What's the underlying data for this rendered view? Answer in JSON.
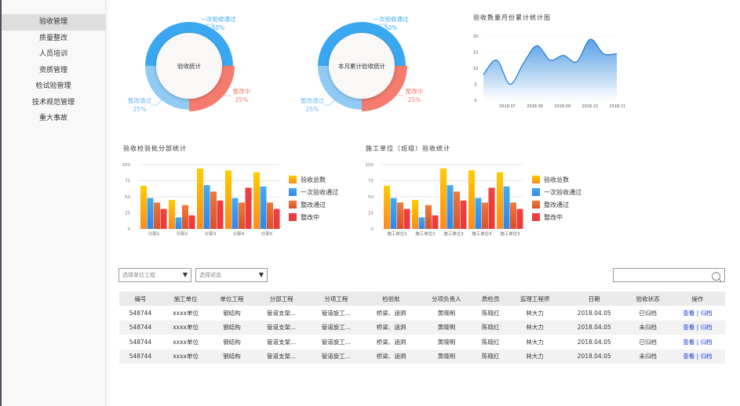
{
  "sidebar": {
    "items": [
      {
        "label": "验收管理",
        "active": true
      },
      {
        "label": "质量整改"
      },
      {
        "label": "人员培训"
      },
      {
        "label": "资质管理"
      },
      {
        "label": "检试验管理"
      },
      {
        "label": "技术规范管理"
      },
      {
        "label": "重大事故"
      }
    ]
  },
  "colors": {
    "donut_first_pass": "#3aa8f0",
    "donut_rectify_passed": "#8fcbf5",
    "donut_rectifying": "#f47b6e",
    "bar_total": "#ffcc00",
    "bar_first_pass": "#45aaf2",
    "bar_rectify_passed": "#f07a3a",
    "bar_rectifying": "#f04040",
    "link": "#1a3bd6"
  },
  "chart_data": [
    {
      "type": "pie",
      "title": "验收统计",
      "categories": [
        "一次验收通过",
        "整改中",
        "整改通过"
      ],
      "values": [
        50,
        25,
        25
      ],
      "labels": [
        "50%",
        "25%",
        "25%"
      ]
    },
    {
      "type": "pie",
      "title": "本月累计验收统计",
      "categories": [
        "一次验收通过",
        "整改中",
        "整改通过"
      ],
      "values": [
        50,
        25,
        25
      ],
      "labels": [
        "50%",
        "25%",
        "25%"
      ]
    },
    {
      "type": "area",
      "title": "验收数量月份累计统计图",
      "x_ticks": [
        "2018.07",
        "2018.08",
        "2018.09",
        "2018.10",
        "2018.11"
      ],
      "y_ticks": [
        "0",
        "5",
        "10",
        "15",
        "20"
      ],
      "ylim": [
        0,
        20
      ],
      "x": [
        0,
        0.5,
        1,
        1.5,
        2,
        2.5,
        3,
        3.5,
        4,
        4.5,
        5
      ],
      "values": [
        8,
        12.5,
        5,
        11.5,
        17,
        12.5,
        14,
        12,
        19,
        14.5,
        14.5
      ],
      "grid": true
    },
    {
      "type": "bar",
      "title": "验收检验批分部统计",
      "categories": [
        "分部1",
        "分部2",
        "分部3",
        "分部4",
        "分部5"
      ],
      "y_ticks": [
        "0",
        "25",
        "50",
        "75",
        "100"
      ],
      "ylim": [
        0,
        100
      ],
      "series": [
        {
          "name": "验收总数",
          "values": [
            67,
            45,
            94,
            91,
            88
          ]
        },
        {
          "name": "一次验收通过",
          "values": [
            48,
            18,
            68,
            48,
            66
          ]
        },
        {
          "name": "整改通过",
          "values": [
            41,
            37,
            58,
            41,
            41
          ]
        },
        {
          "name": "整改中",
          "values": [
            31,
            21,
            44,
            64,
            31
          ]
        }
      ],
      "legend": "right"
    },
    {
      "type": "bar",
      "title": "施工单位（班组）验收统计",
      "categories": [
        "施工单位1",
        "施工单位2",
        "施工单位3",
        "施工单位4",
        "施工单位5"
      ],
      "y_ticks": [
        "0",
        "25",
        "50",
        "75",
        "100"
      ],
      "ylim": [
        0,
        100
      ],
      "series": [
        {
          "name": "验收总数",
          "values": [
            67,
            45,
            94,
            91,
            88
          ]
        },
        {
          "name": "一次验收通过",
          "values": [
            48,
            18,
            68,
            48,
            66
          ]
        },
        {
          "name": "整改通过",
          "values": [
            41,
            37,
            58,
            41,
            41
          ]
        },
        {
          "name": "整改中",
          "values": [
            31,
            21,
            44,
            64,
            31
          ]
        }
      ],
      "legend": "right"
    }
  ],
  "filters": {
    "unit_project_placeholder": "选择单位工程",
    "status_placeholder": "选择状态",
    "search_value": ""
  },
  "table": {
    "headers": [
      "编号",
      "施工单位",
      "单位工程",
      "分部工程",
      "分项工程",
      "检验批",
      "分项负责人",
      "质检员",
      "监理工程师",
      "日期",
      "验收状态",
      "操作"
    ],
    "rows": [
      [
        "548744",
        "xxxx单位",
        "钢结构",
        "管道支架...",
        "管道旋工...",
        "桥梁、涵洞",
        "黄晓明",
        "陈晓红",
        "林大力",
        "2018.04.05",
        "已归档"
      ],
      [
        "548744",
        "xxxx单位",
        "钢结构",
        "管道支架...",
        "管道旋工...",
        "桥梁、涵洞",
        "黄晓明",
        "陈晓红",
        "林大力",
        "2018.04.05",
        "未归档"
      ],
      [
        "548744",
        "xxxx单位",
        "钢结构",
        "管道支架...",
        "管道旋工...",
        "桥梁、涵洞",
        "黄晓明",
        "陈晓红",
        "林大力",
        "2018.04.05",
        "已归档"
      ],
      [
        "548744",
        "xxxx单位",
        "钢结构",
        "管道支架...",
        "管道旋工...",
        "桥梁、涵洞",
        "黄晓明",
        "陈晓红",
        "林大力",
        "2018.04.05",
        "未归档"
      ]
    ],
    "actions": {
      "view": "查看",
      "separator": "|",
      "archive": "归档"
    }
  }
}
